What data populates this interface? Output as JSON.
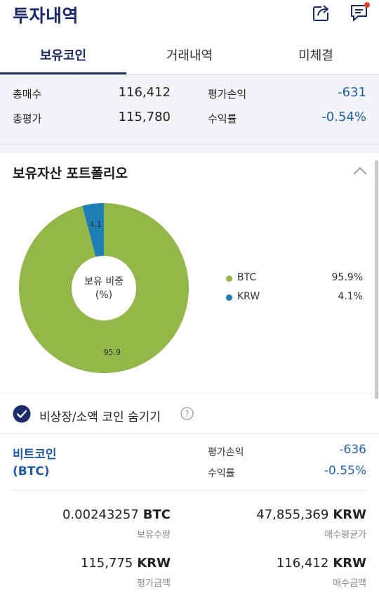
{
  "header": {
    "title": "투자내역",
    "share_icon": "share-icon",
    "chat_icon": "chat-icon",
    "notification_color": "#e0412f"
  },
  "tabs": [
    {
      "label": "보유코인",
      "active": true
    },
    {
      "label": "거래내역",
      "active": false
    },
    {
      "label": "미체결",
      "active": false
    }
  ],
  "summary": {
    "total_buy_label": "총매수",
    "total_buy_value": "116,412",
    "total_eval_label": "총평가",
    "total_eval_value": "115,780",
    "pnl_label": "평가손익",
    "pnl_value": "-631",
    "return_label": "수익률",
    "return_value": "-0.54%"
  },
  "portfolio": {
    "title": "보유자산 포트폴리오",
    "center_label_line1": "보유 비중",
    "center_label_line2": "(%)",
    "legend": [
      {
        "name": "BTC",
        "pct": "95.9%",
        "color": "#94b74a"
      },
      {
        "name": "KRW",
        "pct": "4.1%",
        "color": "#1f7fb5"
      }
    ]
  },
  "chart_data": {
    "type": "pie",
    "categories": [
      "BTC",
      "KRW"
    ],
    "values": [
      95.9,
      4.1
    ],
    "data_labels": [
      "95.9",
      "4.1"
    ],
    "colors": [
      "#94b74a",
      "#1f7fb5"
    ],
    "title": "",
    "legend_position": "right"
  },
  "filter": {
    "checked": true,
    "label": "비상장/소액 코인 숨기기",
    "help_glyph": "?"
  },
  "coin": {
    "name_line1": "비트코인",
    "name_line2": "(BTC)",
    "pnl_label": "평가손익",
    "pnl_value": "-636",
    "return_label": "수익률",
    "return_value": "-0.55%",
    "holding_amount": "0.00243257",
    "holding_unit": "BTC",
    "holding_label": "보유수량",
    "avg_price": "47,855,369",
    "avg_unit": "KRW",
    "avg_label": "매수평균가",
    "eval_amount": "115,775",
    "eval_unit": "KRW",
    "eval_label": "평가금액",
    "buy_amount": "116,412",
    "buy_unit": "KRW",
    "buy_label": "매수금액"
  }
}
